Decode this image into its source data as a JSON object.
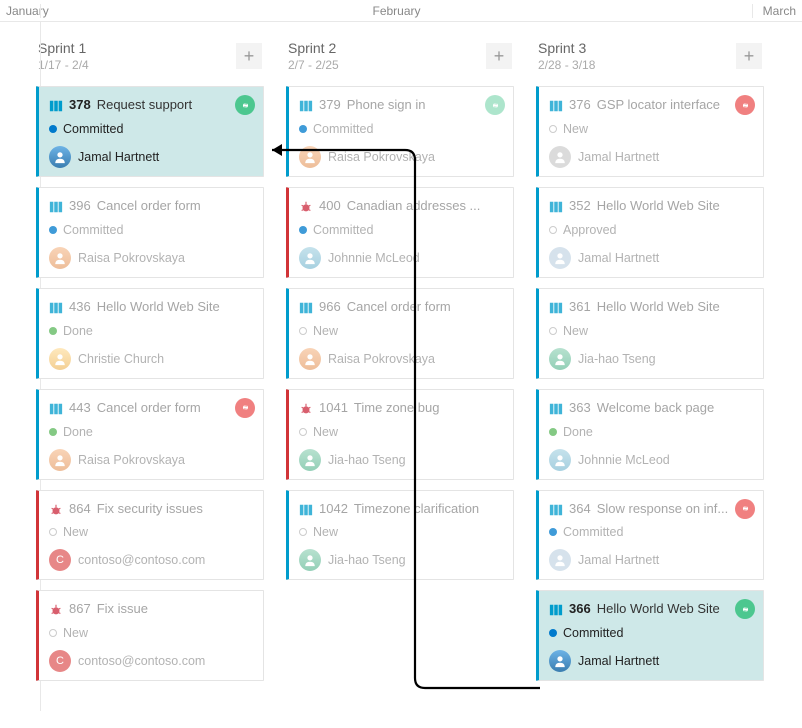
{
  "months": {
    "jan": "January",
    "feb": "February",
    "mar": "March"
  },
  "columns": [
    {
      "name": "Sprint 1",
      "dates": "1/17 - 2/4",
      "cards": [
        {
          "type": "pbi",
          "id": "378",
          "title": "Request support",
          "state": "Committed",
          "stateClass": "committed",
          "assignee": "Jamal Hartnett",
          "avatar": "jamal",
          "badge": "green",
          "hl": true
        },
        {
          "type": "pbi",
          "id": "396",
          "title": "Cancel order form",
          "state": "Committed",
          "stateClass": "committed",
          "assignee": "Raisa Pokrovskaya",
          "avatar": "raisa"
        },
        {
          "type": "pbi",
          "id": "436",
          "title": "Hello World Web Site",
          "state": "Done",
          "stateClass": "done",
          "assignee": "Christie Church",
          "avatar": "christie"
        },
        {
          "type": "pbi",
          "id": "443",
          "title": "Cancel order form",
          "state": "Done",
          "stateClass": "done",
          "assignee": "Raisa Pokrovskaya",
          "avatar": "raisa",
          "badge": "red"
        },
        {
          "type": "bug",
          "id": "864",
          "title": "Fix security issues",
          "state": "New",
          "stateClass": "new",
          "assignee": "contoso@contoso.com",
          "avatar": "contoso"
        },
        {
          "type": "bug",
          "id": "867",
          "title": "Fix issue",
          "state": "New",
          "stateClass": "new",
          "assignee": "contoso@contoso.com",
          "avatar": "contoso"
        }
      ]
    },
    {
      "name": "Sprint 2",
      "dates": "2/7 - 2/25",
      "cards": [
        {
          "type": "pbi",
          "id": "379",
          "title": "Phone sign in",
          "state": "Committed",
          "stateClass": "committed",
          "assignee": "Raisa Pokrovskaya",
          "avatar": "raisa",
          "badge": "green",
          "badgeDim": true
        },
        {
          "type": "bug",
          "id": "400",
          "title": "Canadian addresses ...",
          "state": "Committed",
          "stateClass": "committed",
          "assignee": "Johnnie McLeod",
          "avatar": "johnnie"
        },
        {
          "type": "pbi",
          "id": "966",
          "title": "Cancel order form",
          "state": "New",
          "stateClass": "new",
          "assignee": "Raisa Pokrovskaya",
          "avatar": "raisa"
        },
        {
          "type": "bug",
          "id": "1041",
          "title": "Time zone bug",
          "state": "New",
          "stateClass": "new",
          "assignee": "Jia-hao Tseng",
          "avatar": "jiahao"
        },
        {
          "type": "pbi",
          "id": "1042",
          "title": "Timezone clarification",
          "state": "New",
          "stateClass": "new",
          "assignee": "Jia-hao Tseng",
          "avatar": "jiahao"
        }
      ]
    },
    {
      "name": "Sprint 3",
      "dates": "2/28 - 3/18",
      "cards": [
        {
          "type": "pbi",
          "id": "376",
          "title": "GSP locator interface",
          "state": "New",
          "stateClass": "new",
          "assignee": "Jamal Hartnett",
          "avatar": "unassigned",
          "badge": "red"
        },
        {
          "type": "pbi",
          "id": "352",
          "title": "Hello World Web Site",
          "state": "Approved",
          "stateClass": "approved",
          "assignee": "Jamal Hartnett",
          "avatar": "jamal dim"
        },
        {
          "type": "pbi",
          "id": "361",
          "title": "Hello World Web Site",
          "state": "New",
          "stateClass": "new",
          "assignee": "Jia-hao Tseng",
          "avatar": "jiahao"
        },
        {
          "type": "pbi",
          "id": "363",
          "title": "Welcome back page",
          "state": "Done",
          "stateClass": "done",
          "assignee": "Johnnie McLeod",
          "avatar": "johnnie"
        },
        {
          "type": "pbi",
          "id": "364",
          "title": "Slow response on inf...",
          "state": "Committed",
          "stateClass": "committed",
          "assignee": "Jamal Hartnett",
          "avatar": "jamal dim",
          "badge": "red"
        },
        {
          "type": "pbi",
          "id": "366",
          "title": "Hello World Web Site",
          "state": "Committed",
          "stateClass": "committed",
          "assignee": "Jamal Hartnett",
          "avatar": "jamal",
          "badge": "green",
          "hl": true
        }
      ]
    }
  ],
  "add_label": "+"
}
